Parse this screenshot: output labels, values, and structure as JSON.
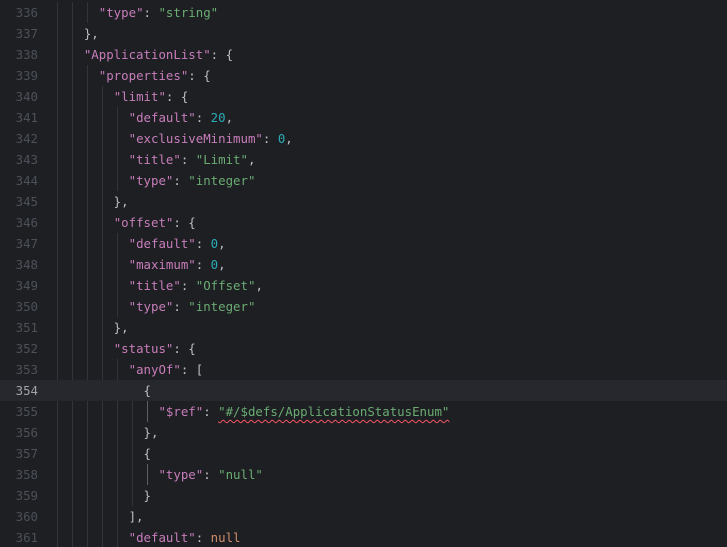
{
  "editor": {
    "current_line": "354",
    "lines": [
      {
        "num": "336",
        "segs": [
          {
            "t": "      ",
            "c": "punc"
          },
          {
            "t": "\"type\"",
            "c": "key"
          },
          {
            "t": ": ",
            "c": "punc"
          },
          {
            "t": "\"string\"",
            "c": "str"
          }
        ]
      },
      {
        "num": "337",
        "segs": [
          {
            "t": "    },",
            "c": "punc"
          }
        ]
      },
      {
        "num": "338",
        "segs": [
          {
            "t": "    ",
            "c": "punc"
          },
          {
            "t": "\"ApplicationList\"",
            "c": "key"
          },
          {
            "t": ": {",
            "c": "punc"
          }
        ]
      },
      {
        "num": "339",
        "segs": [
          {
            "t": "      ",
            "c": "punc"
          },
          {
            "t": "\"properties\"",
            "c": "key"
          },
          {
            "t": ": {",
            "c": "punc"
          }
        ]
      },
      {
        "num": "340",
        "segs": [
          {
            "t": "        ",
            "c": "punc"
          },
          {
            "t": "\"limit\"",
            "c": "key"
          },
          {
            "t": ": {",
            "c": "punc"
          }
        ]
      },
      {
        "num": "341",
        "segs": [
          {
            "t": "          ",
            "c": "punc"
          },
          {
            "t": "\"default\"",
            "c": "key"
          },
          {
            "t": ": ",
            "c": "punc"
          },
          {
            "t": "20",
            "c": "num"
          },
          {
            "t": ",",
            "c": "punc"
          }
        ]
      },
      {
        "num": "342",
        "segs": [
          {
            "t": "          ",
            "c": "punc"
          },
          {
            "t": "\"exclusiveMinimum\"",
            "c": "key"
          },
          {
            "t": ": ",
            "c": "punc"
          },
          {
            "t": "0",
            "c": "num"
          },
          {
            "t": ",",
            "c": "punc"
          }
        ]
      },
      {
        "num": "343",
        "segs": [
          {
            "t": "          ",
            "c": "punc"
          },
          {
            "t": "\"title\"",
            "c": "key"
          },
          {
            "t": ": ",
            "c": "punc"
          },
          {
            "t": "\"Limit\"",
            "c": "str"
          },
          {
            "t": ",",
            "c": "punc"
          }
        ]
      },
      {
        "num": "344",
        "segs": [
          {
            "t": "          ",
            "c": "punc"
          },
          {
            "t": "\"type\"",
            "c": "key"
          },
          {
            "t": ": ",
            "c": "punc"
          },
          {
            "t": "\"integer\"",
            "c": "str"
          }
        ]
      },
      {
        "num": "345",
        "segs": [
          {
            "t": "        },",
            "c": "punc"
          }
        ]
      },
      {
        "num": "346",
        "segs": [
          {
            "t": "        ",
            "c": "punc"
          },
          {
            "t": "\"offset\"",
            "c": "key"
          },
          {
            "t": ": {",
            "c": "punc"
          }
        ]
      },
      {
        "num": "347",
        "segs": [
          {
            "t": "          ",
            "c": "punc"
          },
          {
            "t": "\"default\"",
            "c": "key"
          },
          {
            "t": ": ",
            "c": "punc"
          },
          {
            "t": "0",
            "c": "num"
          },
          {
            "t": ",",
            "c": "punc"
          }
        ]
      },
      {
        "num": "348",
        "segs": [
          {
            "t": "          ",
            "c": "punc"
          },
          {
            "t": "\"maximum\"",
            "c": "key"
          },
          {
            "t": ": ",
            "c": "punc"
          },
          {
            "t": "0",
            "c": "num"
          },
          {
            "t": ",",
            "c": "punc"
          }
        ]
      },
      {
        "num": "349",
        "segs": [
          {
            "t": "          ",
            "c": "punc"
          },
          {
            "t": "\"title\"",
            "c": "key"
          },
          {
            "t": ": ",
            "c": "punc"
          },
          {
            "t": "\"Offset\"",
            "c": "str"
          },
          {
            "t": ",",
            "c": "punc"
          }
        ]
      },
      {
        "num": "350",
        "segs": [
          {
            "t": "          ",
            "c": "punc"
          },
          {
            "t": "\"type\"",
            "c": "key"
          },
          {
            "t": ": ",
            "c": "punc"
          },
          {
            "t": "\"integer\"",
            "c": "str"
          }
        ]
      },
      {
        "num": "351",
        "segs": [
          {
            "t": "        },",
            "c": "punc"
          }
        ]
      },
      {
        "num": "352",
        "segs": [
          {
            "t": "        ",
            "c": "punc"
          },
          {
            "t": "\"status\"",
            "c": "key"
          },
          {
            "t": ": {",
            "c": "punc"
          }
        ]
      },
      {
        "num": "353",
        "segs": [
          {
            "t": "          ",
            "c": "punc"
          },
          {
            "t": "\"anyOf\"",
            "c": "key"
          },
          {
            "t": ": [",
            "c": "punc"
          }
        ]
      },
      {
        "num": "354",
        "segs": [
          {
            "t": "            {",
            "c": "punc"
          }
        ]
      },
      {
        "num": "355",
        "segs": [
          {
            "t": "              ",
            "c": "punc"
          },
          {
            "t": "\"$ref\"",
            "c": "key"
          },
          {
            "t": ": ",
            "c": "punc"
          },
          {
            "t": "\"#/$defs/ApplicationStatusEnum\"",
            "c": "str squiggle"
          }
        ]
      },
      {
        "num": "356",
        "segs": [
          {
            "t": "            },",
            "c": "punc"
          }
        ]
      },
      {
        "num": "357",
        "segs": [
          {
            "t": "            {",
            "c": "punc"
          }
        ]
      },
      {
        "num": "358",
        "segs": [
          {
            "t": "              ",
            "c": "punc"
          },
          {
            "t": "\"type\"",
            "c": "key"
          },
          {
            "t": ": ",
            "c": "punc"
          },
          {
            "t": "\"null\"",
            "c": "str"
          }
        ]
      },
      {
        "num": "359",
        "segs": [
          {
            "t": "            }",
            "c": "punc"
          }
        ]
      },
      {
        "num": "360",
        "segs": [
          {
            "t": "          ],",
            "c": "punc"
          }
        ]
      },
      {
        "num": "361",
        "segs": [
          {
            "t": "          ",
            "c": "punc"
          },
          {
            "t": "\"default\"",
            "c": "key"
          },
          {
            "t": ": ",
            "c": "punc"
          },
          {
            "t": "null",
            "c": "kw"
          }
        ]
      }
    ]
  },
  "colors": {
    "background": "#1e1f22",
    "key": "#c77dbb",
    "string": "#6aab73",
    "number": "#2aacb8",
    "keyword": "#cf8e6d",
    "error_underline": "#f75464"
  }
}
